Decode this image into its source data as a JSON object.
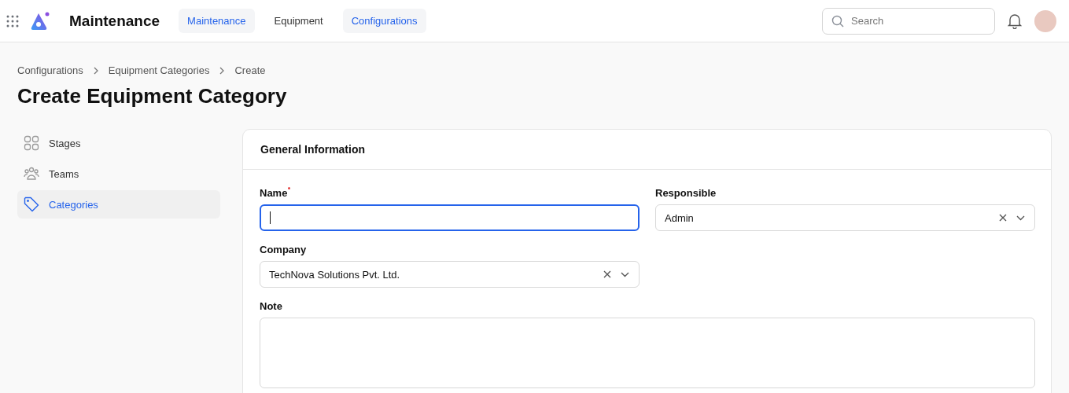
{
  "header": {
    "app_title": "Maintenance",
    "nav": [
      {
        "label": "Maintenance",
        "selected": true
      },
      {
        "label": "Equipment",
        "selected": false
      },
      {
        "label": "Configurations",
        "selected": true
      }
    ],
    "search": {
      "placeholder": "Search"
    }
  },
  "breadcrumbs": [
    "Configurations",
    "Equipment Categories",
    "Create"
  ],
  "page_title": "Create Equipment Category",
  "sidebar": {
    "items": [
      {
        "label": "Stages",
        "selected": false
      },
      {
        "label": "Teams",
        "selected": false
      },
      {
        "label": "Categories",
        "selected": true
      }
    ]
  },
  "form": {
    "title": "General Information",
    "fields": [
      {
        "label": "Name",
        "kind": "text",
        "required": true,
        "focused": true
      },
      {
        "label": "Responsible",
        "kind": "select",
        "value": "Admin",
        "required": false,
        "focused": false
      },
      {
        "label": "Company",
        "kind": "select",
        "value": "TechNova Solutions Pvt. Ltd.",
        "required": false,
        "focused": false
      },
      {
        "label": "Note",
        "kind": "textarea",
        "required": false,
        "focused": false
      }
    ]
  }
}
